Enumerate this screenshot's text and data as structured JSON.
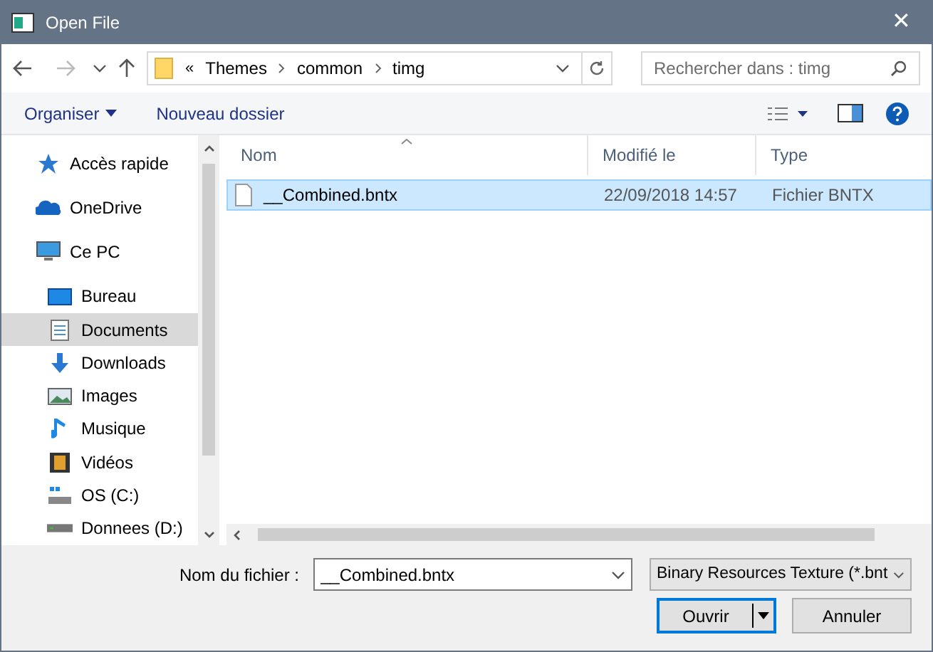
{
  "window": {
    "title": "Open File",
    "close": "✕"
  },
  "address": {
    "overflow": "«",
    "path": [
      "Themes",
      "common",
      "timg"
    ]
  },
  "search": {
    "placeholder": "Rechercher dans : timg"
  },
  "toolbar": {
    "organize": "Organiser",
    "new_folder": "Nouveau dossier"
  },
  "sidebar": {
    "items": [
      {
        "label": "Accès rapide",
        "kind": "top",
        "selected": false
      },
      {
        "label": "OneDrive",
        "kind": "top",
        "selected": false
      },
      {
        "label": "Ce PC",
        "kind": "top",
        "selected": false
      },
      {
        "label": "Bureau",
        "kind": "child",
        "selected": false
      },
      {
        "label": "Documents",
        "kind": "child",
        "selected": true
      },
      {
        "label": "Downloads",
        "kind": "child",
        "selected": false
      },
      {
        "label": "Images",
        "kind": "child",
        "selected": false
      },
      {
        "label": "Musique",
        "kind": "child",
        "selected": false
      },
      {
        "label": "Vidéos",
        "kind": "child",
        "selected": false
      },
      {
        "label": "OS (C:)",
        "kind": "child",
        "selected": false
      },
      {
        "label": "Donnees (D:)",
        "kind": "child",
        "selected": false
      }
    ]
  },
  "table": {
    "columns": [
      "Nom",
      "Modifié le",
      "Type"
    ],
    "rows": [
      {
        "name": "__Combined.bntx",
        "modified": "22/09/2018 14:57",
        "type": "Fichier BNTX",
        "selected": true
      }
    ]
  },
  "footer": {
    "filename_label": "Nom du fichier :",
    "filename": "__Combined.bntx",
    "filter": "Binary Resources Texture (*.bnt",
    "open": "Ouvrir",
    "cancel": "Annuler"
  }
}
